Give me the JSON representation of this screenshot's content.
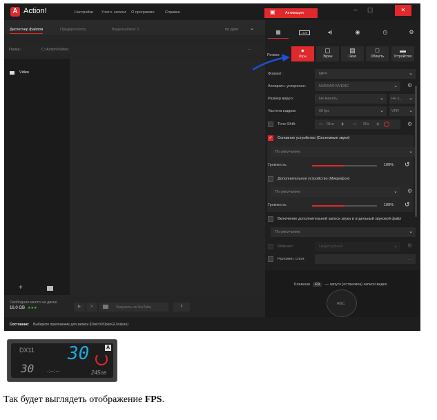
{
  "app": {
    "logo_letter": "A",
    "name": "Action!",
    "menu": [
      "Настройки",
      "Учетн. записи",
      "О программе",
      "Справка"
    ],
    "activate_label": "Активация",
    "window_controls": [
      "–",
      "☐",
      "✕"
    ]
  },
  "left": {
    "tabs": {
      "files": "Диспетчер файлов",
      "preview": "Предпросмотр",
      "videos": "Видеозаписи: 0",
      "sort": "по дате"
    },
    "folder_label": "Папка:",
    "folder_path": "C:\\Action!\\Video",
    "folder_more": "...",
    "tree_item": "Video",
    "free_space_label": "Свободное место на диске",
    "free_space_value": "16.0 GB",
    "free_space_stars": "★★★",
    "youtube_label": "Загрузить на YouTube"
  },
  "status": {
    "label": "Состояние:",
    "text": "Выберите приложение для записи (DirectX/OpenGL/Vulkan)"
  },
  "right": {
    "tab_icons": [
      "film-icon",
      "live-icon",
      "sound-icon",
      "camera-icon",
      "benchmark-icon",
      "gear-icon"
    ],
    "live_label": "LIVE",
    "mode_label": "Режим:",
    "modes": [
      "Игры",
      "Экран",
      "Окно",
      "Область",
      "Устройство"
    ],
    "format": {
      "label": "Формат:",
      "value": "MP4"
    },
    "hw": {
      "label": "Аппаратн. ускорение:",
      "value": "NVIDIA® NVENC"
    },
    "size": {
      "label": "Размер видео:",
      "value": "Не менять",
      "value2": "Не з..."
    },
    "fps": {
      "label": "Частота кадров:",
      "value": "60 fps",
      "value2": "VFR"
    },
    "timeshift": {
      "label": "Time-Shift:",
      "minus": "—",
      "min": "01m",
      "plus": "+",
      "sec": "00s"
    },
    "main_device": {
      "label": "Основное устройство (Системные звуки)",
      "value": "По умолчанию"
    },
    "volume1": {
      "label": "Громкость:",
      "value": "100%",
      "level": 0.5
    },
    "extra_device": {
      "label": "Дополнительное устройство (Микрофон)",
      "value": "По умолчанию"
    },
    "volume2": {
      "label": "Громкость:",
      "value": "100%",
      "level": 0.5
    },
    "separate_audio": {
      "label": "Включение дополнительной записи звука в отдельный звуковой файл",
      "value": "По умолчанию"
    },
    "webcam": {
      "label": "Webcam:",
      "value": "Недоступный"
    },
    "overlay": {
      "label": "Наложен. слоя:",
      "value": "..."
    },
    "hotkey": {
      "prefix": "Клавиша",
      "key": "F9",
      "suffix": "— запуск (остановка) записи видео"
    },
    "rec_label": "REC"
  },
  "osd": {
    "api": "DX11",
    "fps_big": "30",
    "fps_small": "30",
    "timer": "-:--:--",
    "size": "245",
    "size_unit": "GB",
    "logo_letter": "A"
  },
  "caption": {
    "before": "Так будет выглядеть отображение ",
    "bold": "FPS",
    "after": "."
  },
  "colors": {
    "accent": "#e0292d",
    "panel": "#2a2a2a",
    "osd_digits": "#22a8e0",
    "arrow": "#1f4fd8"
  }
}
